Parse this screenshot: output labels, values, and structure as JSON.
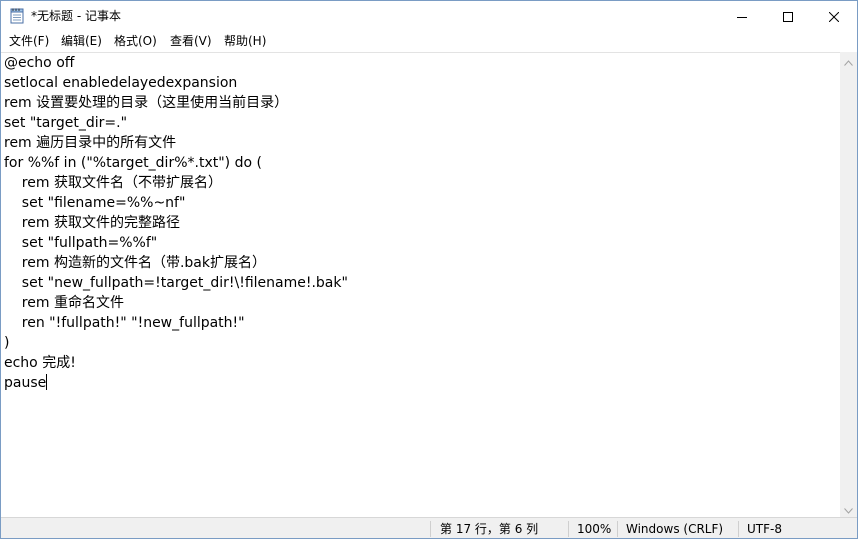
{
  "window": {
    "title": "*无标题 - 记事本"
  },
  "menu": {
    "file": "文件(F)",
    "edit": "编辑(E)",
    "format": "格式(O)",
    "view": "查看(V)",
    "help": "帮助(H)"
  },
  "editor": {
    "lines": [
      "@echo off",
      "setlocal enabledelayedexpansion",
      "rem 设置要处理的目录（这里使用当前目录）",
      "set \"target_dir=.\"",
      "rem 遍历目录中的所有文件",
      "for %%f in (\"%target_dir%*.txt\") do (",
      "    rem 获取文件名（不带扩展名）",
      "    set \"filename=%%~nf\"",
      "    rem 获取文件的完整路径",
      "    set \"fullpath=%%f\"",
      "    rem 构造新的文件名（带.bak扩展名）",
      "    set \"new_fullpath=!target_dir!\\!filename!.bak\"",
      "    rem 重命名文件",
      "    ren \"!fullpath!\" \"!new_fullpath!\"",
      ")",
      "echo 完成!",
      "pause"
    ]
  },
  "status": {
    "position": "第 17 行，第 6 列",
    "zoom": "100%",
    "line_ending": "Windows (CRLF)",
    "encoding": "UTF-8"
  },
  "icons": {
    "app": "notepad-icon",
    "minimize": "minimize-icon",
    "maximize": "maximize-icon",
    "close": "close-icon",
    "scroll_up": "chevron-up-icon",
    "scroll_down": "chevron-down-icon"
  }
}
